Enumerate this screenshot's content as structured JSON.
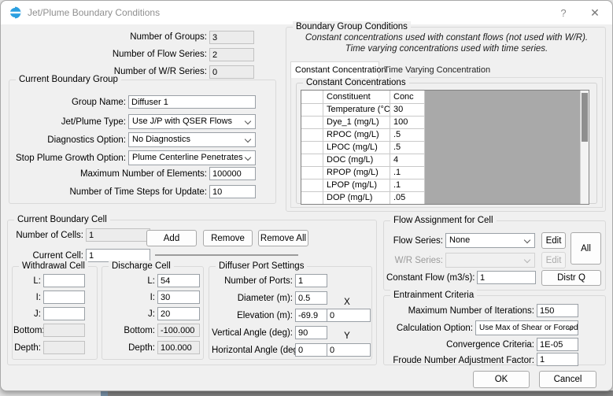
{
  "titlebar": {
    "title": "Jet/Plume Boundary Conditions",
    "help_label": "?",
    "close_label": "✕"
  },
  "counts": {
    "groups_label": "Number of Groups:",
    "groups_value": "3",
    "flow_series_label": "Number of Flow Series:",
    "flow_series_value": "2",
    "wr_series_label": "Number of W/R Series:",
    "wr_series_value": "0"
  },
  "current_group": {
    "title": "Current Boundary Group",
    "group_name_label": "Group Name:",
    "group_name_value": "Diffuser 1",
    "jet_plume_type_label": "Jet/Plume Type:",
    "jet_plume_type_value": "Use J/P with QSER Flows",
    "diagnostics_label": "Diagnostics Option:",
    "diagnostics_value": "No Diagnostics",
    "stop_plume_label": "Stop Plume Growth Option:",
    "stop_plume_value": "Plume Centerline Penetrates",
    "max_elements_label": "Maximum Number of Elements:",
    "max_elements_value": "100000",
    "time_steps_label": "Number of Time Steps for Update:",
    "time_steps_value": "10"
  },
  "boundary_conditions": {
    "title": "Boundary Group Conditions",
    "note_line1": "Constant concentrations used with constant flows (not used with W/R).",
    "note_line2": "Time varying concentrations used with time series.",
    "tab_constant": "Constant Concentration",
    "tab_time_varying": "Time Varying Concentration",
    "table_title": "Constant Concentrations",
    "table": {
      "headers": {
        "constituent": "Constituent",
        "conc": "Conc"
      },
      "rows": [
        {
          "constituent": "Temperature (°C)",
          "conc": "30"
        },
        {
          "constituent": "Dye_1 (mg/L)",
          "conc": "100"
        },
        {
          "constituent": "RPOC (mg/L)",
          "conc": ".5"
        },
        {
          "constituent": "LPOC (mg/L)",
          "conc": ".5"
        },
        {
          "constituent": "DOC (mg/L)",
          "conc": "4"
        },
        {
          "constituent": "RPOP (mg/L)",
          "conc": ".1"
        },
        {
          "constituent": "LPOP (mg/L)",
          "conc": ".1"
        },
        {
          "constituent": "DOP (mg/L)",
          "conc": ".05"
        }
      ]
    }
  },
  "current_cell": {
    "title": "Current Boundary Cell",
    "number_of_cells_label": "Number of Cells:",
    "number_of_cells_value": "1",
    "current_cell_label": "Current Cell:",
    "current_cell_value": "1",
    "add_label": "Add",
    "remove_label": "Remove",
    "remove_all_label": "Remove All",
    "withdrawal": {
      "title": "Withdrawal Cell",
      "l_label": "L:",
      "i_label": "I:",
      "j_label": "J:",
      "bottom_label": "Bottom:",
      "depth_label": "Depth:",
      "l_value": "",
      "i_value": "",
      "j_value": "",
      "bottom_value": "",
      "depth_value": ""
    },
    "discharge": {
      "title": "Discharge Cell",
      "l_label": "L:",
      "i_label": "I:",
      "j_label": "J:",
      "bottom_label": "Bottom:",
      "depth_label": "Depth:",
      "l_value": "54",
      "i_value": "30",
      "j_value": "20",
      "bottom_value": "-100.000",
      "depth_value": "100.000"
    },
    "diffuser": {
      "title": "Diffuser Port Settings",
      "ports_label": "Number of Ports:",
      "ports_value": "1",
      "diameter_label": "Diameter (m):",
      "diameter_value": "0.5",
      "elevation_label": "Elevation (m):",
      "elevation_value": "-69.9",
      "x_label": "X",
      "x_value": "0",
      "vertical_label": "Vertical Angle (deg):",
      "vertical_value": "90",
      "y_label": "Y",
      "y_value": "0",
      "horizontal_label": "Horizontal Angle (deg):",
      "horizontal_value": "0"
    }
  },
  "flow_assignment": {
    "title": "Flow Assignment for Cell",
    "flow_series_label": "Flow Series:",
    "flow_series_value": "None",
    "wr_series_label": "W/R Series:",
    "wr_series_value": "",
    "edit_label": "Edit",
    "all_label": "All",
    "constant_flow_label": "Constant Flow (m3/s):",
    "constant_flow_value": "1",
    "distr_q_label": "Distr Q"
  },
  "entrainment": {
    "title": "Entrainment Criteria",
    "iterations_label": "Maximum Number of Iterations:",
    "iterations_value": "150",
    "calc_option_label": "Calculation Option:",
    "calc_option_value": "Use Max of Shear or Forced",
    "convergence_label": "Convergence Criteria:",
    "convergence_value": "1E-05",
    "froude_label": "Froude Number Adjustment Factor:",
    "froude_value": "1"
  },
  "footer": {
    "ok_label": "OK",
    "cancel_label": "Cancel"
  },
  "colors": {
    "accent_blue": "#2b9fe0",
    "table_fill": "#a9a9a9"
  }
}
